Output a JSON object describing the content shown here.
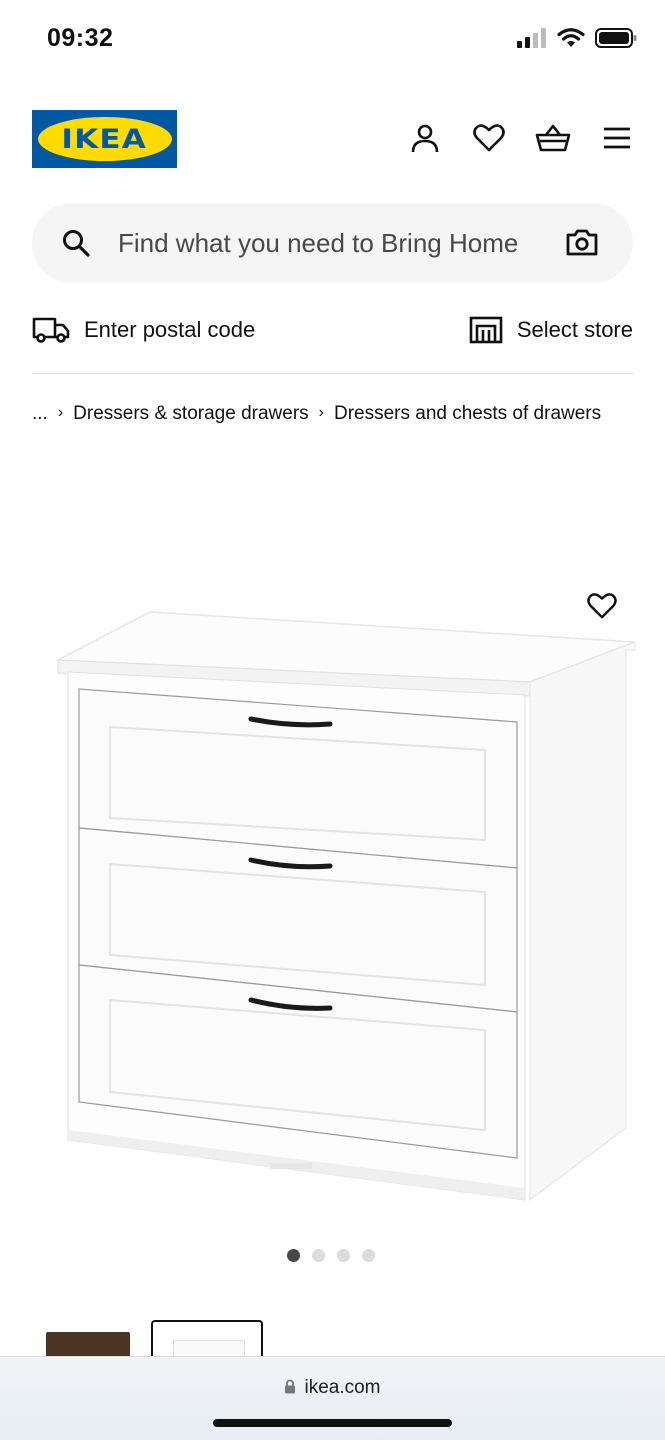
{
  "status_bar": {
    "time": "09:32"
  },
  "header": {
    "logo_text": "IKEA",
    "icons": [
      "user-icon",
      "heart-icon",
      "basket-icon",
      "menu-icon"
    ]
  },
  "search": {
    "placeholder": "Find what you need to Bring Home"
  },
  "delivery": {
    "postal_label": "Enter postal code",
    "store_label": "Select store"
  },
  "breadcrumb": {
    "ellipsis": "...",
    "items": [
      "Dressers & storage drawers",
      "Dressers and chests of drawers"
    ]
  },
  "carousel": {
    "total": 4,
    "active_index": 0
  },
  "browser": {
    "url": "ikea.com"
  },
  "colors": {
    "ikea_blue": "#0058a3",
    "ikea_yellow": "#ffdb00",
    "search_bg": "#f5f5f5",
    "thumb_brown": "#4c3322"
  }
}
